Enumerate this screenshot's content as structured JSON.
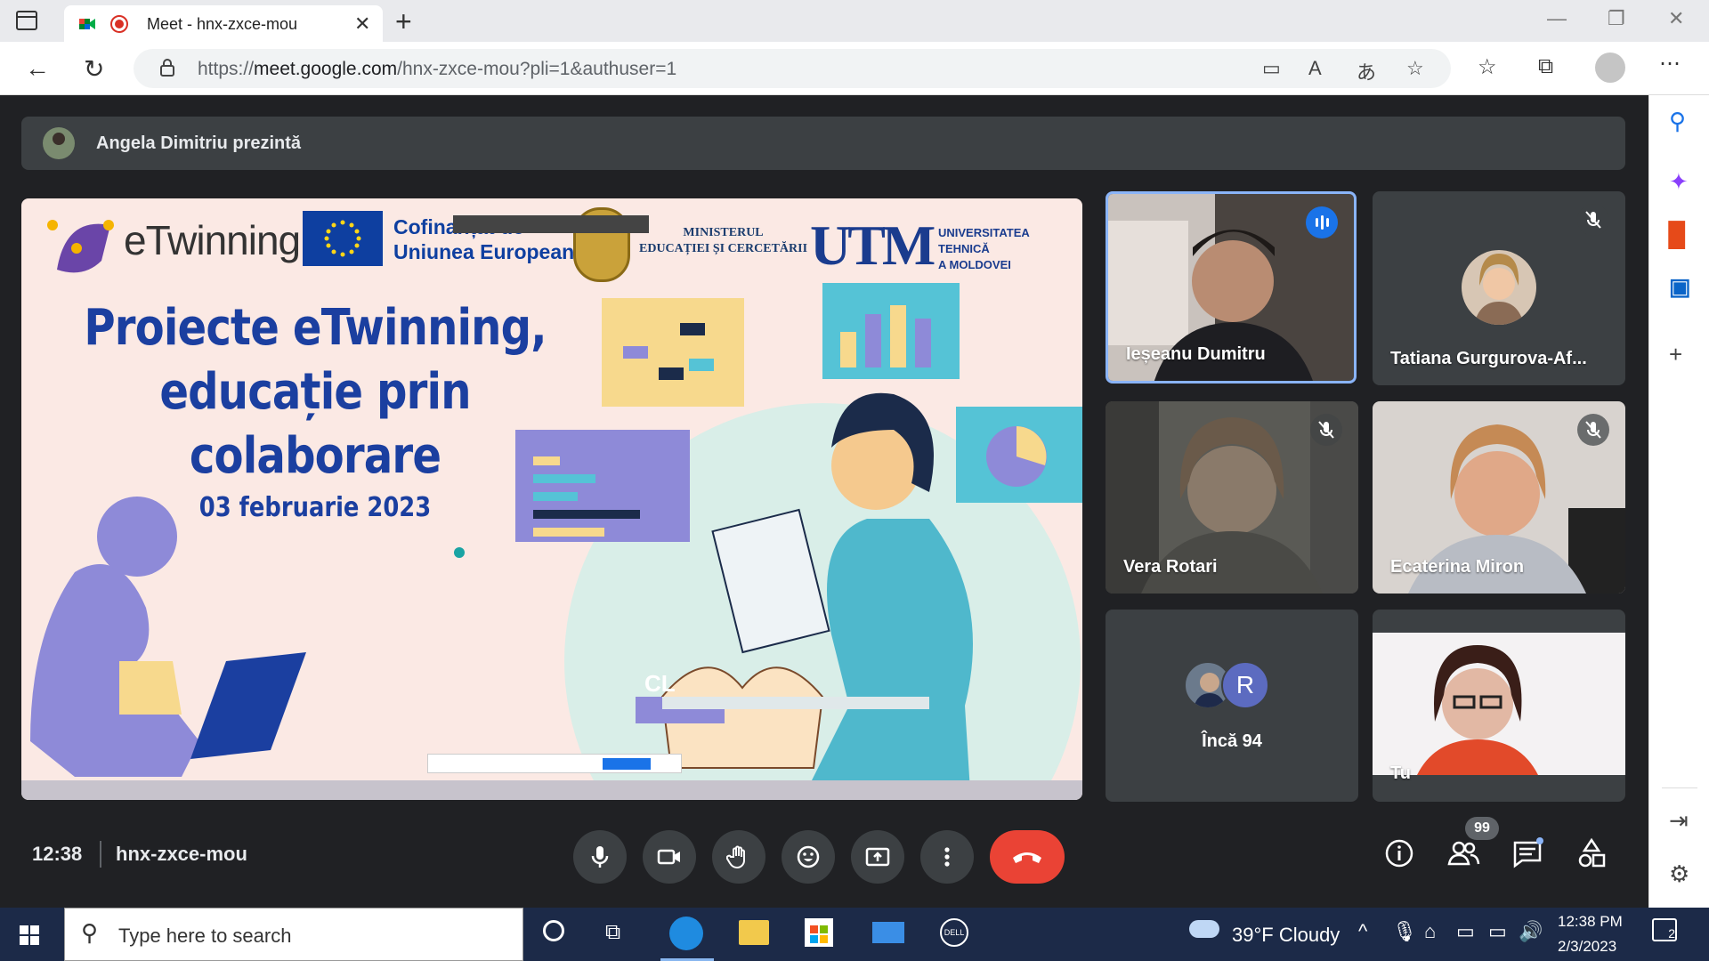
{
  "browser": {
    "tab_title": "Meet - hnx-zxce-mou",
    "url_prefix": "https://",
    "url_host": "meet.google.com",
    "url_path": "/hnx-zxce-mou?pli=1&authuser=1"
  },
  "presenter_banner": "Angela Dimitriu prezintă",
  "slide": {
    "logo_etwinning": "eTwinning",
    "eu_text_line1": "Cofinanțat de",
    "eu_text_line2": "Uniunea Europeană",
    "ministry_line1": "MINISTERUL",
    "ministry_line2": "EDUCAȚIEI ȘI CERCETĂRII",
    "utm_logo": "UTM",
    "utm_line1": "UNIVERSITATEA TEHNICĂ",
    "utm_line2": "A MOLDOVEI",
    "title_line1": "Proiecte eTwinning,",
    "title_line2": "educație prin colaborare",
    "date": "03 februarie 2023",
    "screen_label": "CL"
  },
  "participants": [
    {
      "name": "Ieșeanu Dumitru",
      "state": "speaking"
    },
    {
      "name": "Tatiana Gurgurova-Af...",
      "state": "muted"
    },
    {
      "name": "Vera Rotari",
      "state": "muted"
    },
    {
      "name": "Ecaterina Miron",
      "state": "muted"
    },
    {
      "name": "Încă 94",
      "state": "overflow",
      "avatar_letter": "R"
    },
    {
      "name": "Tu",
      "state": "self"
    }
  ],
  "meeting": {
    "time": "12:38",
    "code": "hnx-zxce-mou",
    "participants_badge": "99"
  },
  "taskbar": {
    "search_placeholder": "Type here to search",
    "weather": "39°F  Cloudy",
    "time": "12:38 PM",
    "date": "2/3/2023",
    "notifications": "2"
  },
  "colors": {
    "meet_bg": "#202124",
    "end_call": "#ea4335",
    "speaking_border": "#8ab4f8",
    "slide_blue": "#1b3fa0"
  }
}
